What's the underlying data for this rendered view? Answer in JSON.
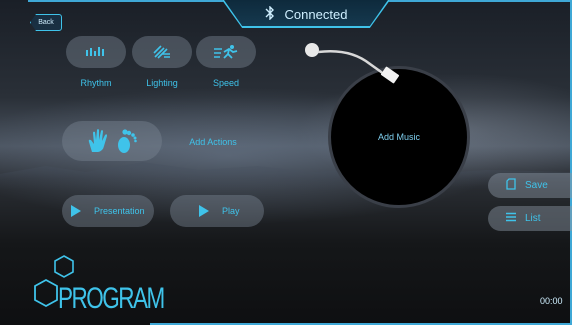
{
  "header": {
    "back_label": "Back",
    "status_label": "Connected",
    "status_icon": "bluetooth-icon"
  },
  "controls": {
    "rhythm_label": "Rhythm",
    "lighting_label": "Lighting",
    "speed_label": "Speed",
    "add_actions_label": "Add Actions",
    "presentation_label": "Presentation",
    "play_label": "Play"
  },
  "music": {
    "add_music_label": "Add Music"
  },
  "side": {
    "save_label": "Save",
    "list_label": "List"
  },
  "footer": {
    "program_label": "PROGRAM",
    "time": "00:00"
  },
  "colors": {
    "accent": "#3fc3ea",
    "text_light": "#cfefff"
  }
}
